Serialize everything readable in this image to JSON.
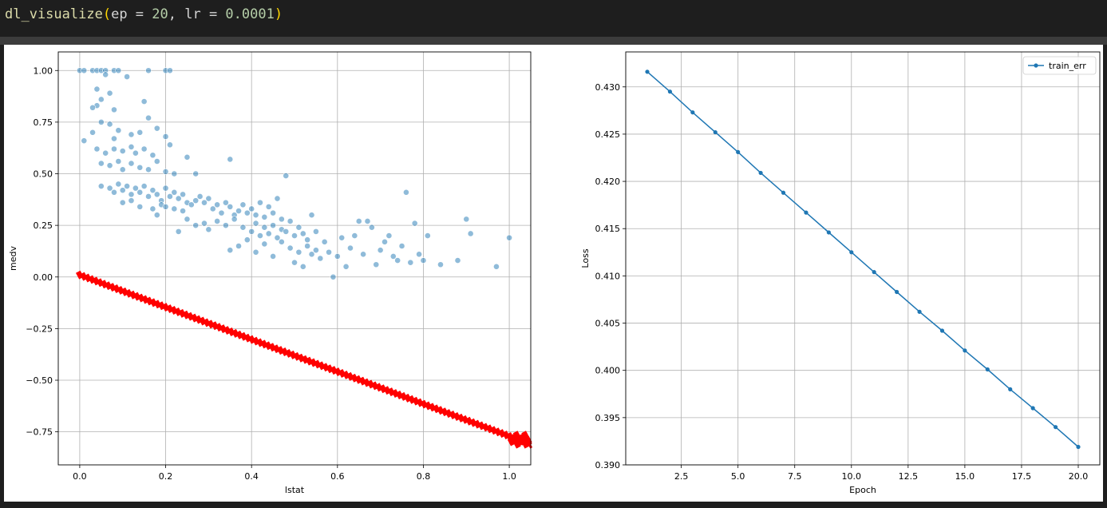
{
  "code": {
    "fn": "dl_visualize",
    "open": "(",
    "args_ep": "ep = ",
    "ep": "20",
    "comma": ", ",
    "args_lr": "lr = ",
    "lr": "0.0001",
    "close": ")"
  },
  "chart_data": [
    {
      "type": "scatter",
      "xlabel": "lstat",
      "ylabel": "medv",
      "xlim": [
        -0.05,
        1.05
      ],
      "ylim": [
        -0.91,
        1.09
      ],
      "xticks": [
        "0.0",
        "0.2",
        "0.4",
        "0.6",
        "0.8",
        "1.0"
      ],
      "xtick_values": [
        0.0,
        0.2,
        0.4,
        0.6,
        0.8,
        1.0
      ],
      "yticks": [
        "1.00",
        "0.75",
        "0.50",
        "0.25",
        "0.00",
        "−0.25",
        "−0.50",
        "−0.75"
      ],
      "ytick_values": [
        1.0,
        0.75,
        0.5,
        0.25,
        0.0,
        -0.25,
        -0.5,
        -0.75
      ],
      "grid": true,
      "series": [
        {
          "kind": "points",
          "color": "#1f77b4",
          "alpha": 0.5,
          "points": [
            [
              0.0,
              1.0
            ],
            [
              0.01,
              1.0
            ],
            [
              0.03,
              1.0
            ],
            [
              0.04,
              1.0
            ],
            [
              0.05,
              1.0
            ],
            [
              0.06,
              1.0
            ],
            [
              0.08,
              1.0
            ],
            [
              0.09,
              1.0
            ],
            [
              0.16,
              1.0
            ],
            [
              0.2,
              1.0
            ],
            [
              0.21,
              1.0
            ],
            [
              0.06,
              0.98
            ],
            [
              0.11,
              0.97
            ],
            [
              0.04,
              0.91
            ],
            [
              0.07,
              0.89
            ],
            [
              0.05,
              0.86
            ],
            [
              0.04,
              0.83
            ],
            [
              0.08,
              0.81
            ],
            [
              0.15,
              0.85
            ],
            [
              0.16,
              0.77
            ],
            [
              0.03,
              0.82
            ],
            [
              0.05,
              0.75
            ],
            [
              0.07,
              0.74
            ],
            [
              0.09,
              0.71
            ],
            [
              0.12,
              0.69
            ],
            [
              0.14,
              0.7
            ],
            [
              0.18,
              0.72
            ],
            [
              0.2,
              0.68
            ],
            [
              0.03,
              0.7
            ],
            [
              0.01,
              0.66
            ],
            [
              0.08,
              0.67
            ],
            [
              0.04,
              0.62
            ],
            [
              0.06,
              0.6
            ],
            [
              0.08,
              0.62
            ],
            [
              0.1,
              0.61
            ],
            [
              0.12,
              0.63
            ],
            [
              0.13,
              0.6
            ],
            [
              0.15,
              0.62
            ],
            [
              0.17,
              0.59
            ],
            [
              0.21,
              0.64
            ],
            [
              0.25,
              0.58
            ],
            [
              0.05,
              0.55
            ],
            [
              0.07,
              0.54
            ],
            [
              0.09,
              0.56
            ],
            [
              0.1,
              0.52
            ],
            [
              0.12,
              0.55
            ],
            [
              0.14,
              0.53
            ],
            [
              0.16,
              0.52
            ],
            [
              0.18,
              0.56
            ],
            [
              0.2,
              0.51
            ],
            [
              0.22,
              0.5
            ],
            [
              0.27,
              0.5
            ],
            [
              0.35,
              0.57
            ],
            [
              0.48,
              0.49
            ],
            [
              0.05,
              0.44
            ],
            [
              0.07,
              0.43
            ],
            [
              0.08,
              0.41
            ],
            [
              0.09,
              0.45
            ],
            [
              0.1,
              0.42
            ],
            [
              0.11,
              0.44
            ],
            [
              0.12,
              0.4
            ],
            [
              0.13,
              0.43
            ],
            [
              0.14,
              0.41
            ],
            [
              0.15,
              0.44
            ],
            [
              0.16,
              0.39
            ],
            [
              0.17,
              0.42
            ],
            [
              0.18,
              0.4
            ],
            [
              0.19,
              0.37
            ],
            [
              0.2,
              0.43
            ],
            [
              0.21,
              0.39
            ],
            [
              0.22,
              0.41
            ],
            [
              0.23,
              0.38
            ],
            [
              0.24,
              0.4
            ],
            [
              0.25,
              0.36
            ],
            [
              0.1,
              0.36
            ],
            [
              0.12,
              0.37
            ],
            [
              0.14,
              0.34
            ],
            [
              0.17,
              0.33
            ],
            [
              0.19,
              0.35
            ],
            [
              0.2,
              0.34
            ],
            [
              0.22,
              0.33
            ],
            [
              0.24,
              0.32
            ],
            [
              0.26,
              0.35
            ],
            [
              0.27,
              0.37
            ],
            [
              0.28,
              0.39
            ],
            [
              0.29,
              0.36
            ],
            [
              0.3,
              0.38
            ],
            [
              0.31,
              0.33
            ],
            [
              0.32,
              0.35
            ],
            [
              0.33,
              0.31
            ],
            [
              0.34,
              0.36
            ],
            [
              0.35,
              0.34
            ],
            [
              0.36,
              0.3
            ],
            [
              0.37,
              0.32
            ],
            [
              0.38,
              0.35
            ],
            [
              0.39,
              0.31
            ],
            [
              0.4,
              0.33
            ],
            [
              0.41,
              0.3
            ],
            [
              0.42,
              0.36
            ],
            [
              0.43,
              0.29
            ],
            [
              0.44,
              0.34
            ],
            [
              0.45,
              0.31
            ],
            [
              0.46,
              0.38
            ],
            [
              0.47,
              0.28
            ],
            [
              0.18,
              0.3
            ],
            [
              0.23,
              0.22
            ],
            [
              0.25,
              0.28
            ],
            [
              0.27,
              0.25
            ],
            [
              0.29,
              0.26
            ],
            [
              0.3,
              0.23
            ],
            [
              0.32,
              0.27
            ],
            [
              0.34,
              0.25
            ],
            [
              0.36,
              0.28
            ],
            [
              0.38,
              0.24
            ],
            [
              0.4,
              0.22
            ],
            [
              0.41,
              0.26
            ],
            [
              0.42,
              0.2
            ],
            [
              0.43,
              0.24
            ],
            [
              0.44,
              0.21
            ],
            [
              0.45,
              0.25
            ],
            [
              0.46,
              0.19
            ],
            [
              0.47,
              0.23
            ],
            [
              0.48,
              0.22
            ],
            [
              0.49,
              0.27
            ],
            [
              0.5,
              0.2
            ],
            [
              0.51,
              0.24
            ],
            [
              0.52,
              0.21
            ],
            [
              0.53,
              0.18
            ],
            [
              0.54,
              0.3
            ],
            [
              0.55,
              0.22
            ],
            [
              0.35,
              0.13
            ],
            [
              0.37,
              0.15
            ],
            [
              0.39,
              0.18
            ],
            [
              0.41,
              0.12
            ],
            [
              0.43,
              0.16
            ],
            [
              0.45,
              0.1
            ],
            [
              0.47,
              0.17
            ],
            [
              0.49,
              0.14
            ],
            [
              0.5,
              0.07
            ],
            [
              0.51,
              0.12
            ],
            [
              0.52,
              0.05
            ],
            [
              0.53,
              0.15
            ],
            [
              0.54,
              0.11
            ],
            [
              0.55,
              0.13
            ],
            [
              0.56,
              0.09
            ],
            [
              0.57,
              0.17
            ],
            [
              0.58,
              0.12
            ],
            [
              0.59,
              0.0
            ],
            [
              0.6,
              0.1
            ],
            [
              0.61,
              0.19
            ],
            [
              0.62,
              0.05
            ],
            [
              0.63,
              0.14
            ],
            [
              0.64,
              0.2
            ],
            [
              0.65,
              0.27
            ],
            [
              0.66,
              0.11
            ],
            [
              0.67,
              0.27
            ],
            [
              0.68,
              0.24
            ],
            [
              0.69,
              0.06
            ],
            [
              0.7,
              0.13
            ],
            [
              0.71,
              0.17
            ],
            [
              0.72,
              0.2
            ],
            [
              0.73,
              0.1
            ],
            [
              0.74,
              0.08
            ],
            [
              0.75,
              0.15
            ],
            [
              0.76,
              0.41
            ],
            [
              0.77,
              0.07
            ],
            [
              0.78,
              0.26
            ],
            [
              0.79,
              0.11
            ],
            [
              0.8,
              0.08
            ],
            [
              0.81,
              0.2
            ],
            [
              0.84,
              0.06
            ],
            [
              0.88,
              0.08
            ],
            [
              0.9,
              0.28
            ],
            [
              0.91,
              0.21
            ],
            [
              0.97,
              0.05
            ],
            [
              1.0,
              0.19
            ]
          ]
        },
        {
          "kind": "band",
          "color": "#ff0000",
          "x": [
            0.0,
            1.05
          ],
          "y": [
            0.01,
            -0.81
          ]
        }
      ]
    },
    {
      "type": "line",
      "xlabel": "Epoch",
      "ylabel": "Loss",
      "xlim": [
        0.05,
        20.95
      ],
      "ylim": [
        0.39,
        0.4337
      ],
      "xticks": [
        "2.5",
        "5.0",
        "7.5",
        "10.0",
        "12.5",
        "15.0",
        "17.5",
        "20.0"
      ],
      "xtick_values": [
        2.5,
        5.0,
        7.5,
        10.0,
        12.5,
        15.0,
        17.5,
        20.0
      ],
      "yticks": [
        "0.430",
        "0.425",
        "0.420",
        "0.415",
        "0.410",
        "0.405",
        "0.400",
        "0.395",
        "0.390"
      ],
      "ytick_values": [
        0.43,
        0.425,
        0.42,
        0.415,
        0.41,
        0.405,
        0.4,
        0.395,
        0.39
      ],
      "grid": true,
      "legend": "top-right",
      "series": [
        {
          "name": "train_err",
          "color": "#1f77b4",
          "x": [
            1,
            2,
            3,
            4,
            5,
            6,
            7,
            8,
            9,
            10,
            11,
            12,
            13,
            14,
            15,
            16,
            17,
            18,
            19,
            20
          ],
          "values": [
            0.4316,
            0.4295,
            0.4273,
            0.4252,
            0.4231,
            0.4209,
            0.4188,
            0.4167,
            0.4146,
            0.4125,
            0.4104,
            0.4083,
            0.4062,
            0.4042,
            0.4021,
            0.4001,
            0.398,
            0.396,
            0.394,
            0.3919
          ]
        }
      ]
    }
  ]
}
